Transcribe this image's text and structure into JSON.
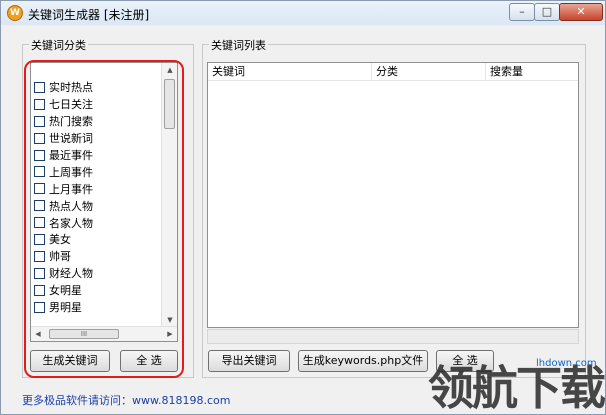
{
  "window": {
    "title": "关键词生成器 [未注册]",
    "app_icon_glyph": "W",
    "controls": {
      "minimize": "–",
      "maximize": "□",
      "close": "✕"
    }
  },
  "left_panel": {
    "group_label": "关键词分类",
    "categories": [
      "实时热点",
      "七日关注",
      "热门搜索",
      "世说新词",
      "最近事件",
      "上周事件",
      "上月事件",
      "热点人物",
      "名家人物",
      "美女",
      "帅哥",
      "财经人物",
      "女明星",
      "男明星"
    ],
    "generate_button": "生成关键词",
    "select_all_button": "全 选",
    "hscroll_grip": "III"
  },
  "right_panel": {
    "group_label": "关键词列表",
    "columns": [
      "关键词",
      "分类",
      "搜索量"
    ],
    "export_button": "导出关键词",
    "generate_php_button": "生成keywords.php文件",
    "select_all_button": "全 选"
  },
  "footer": {
    "link_text": "更多极品软件请访问：www.818198.com"
  },
  "watermark": {
    "text": "领航下载",
    "url": "lhdown.com"
  },
  "colors": {
    "highlight_outline": "#e21b1b",
    "footer_link": "#1a3ea8"
  }
}
